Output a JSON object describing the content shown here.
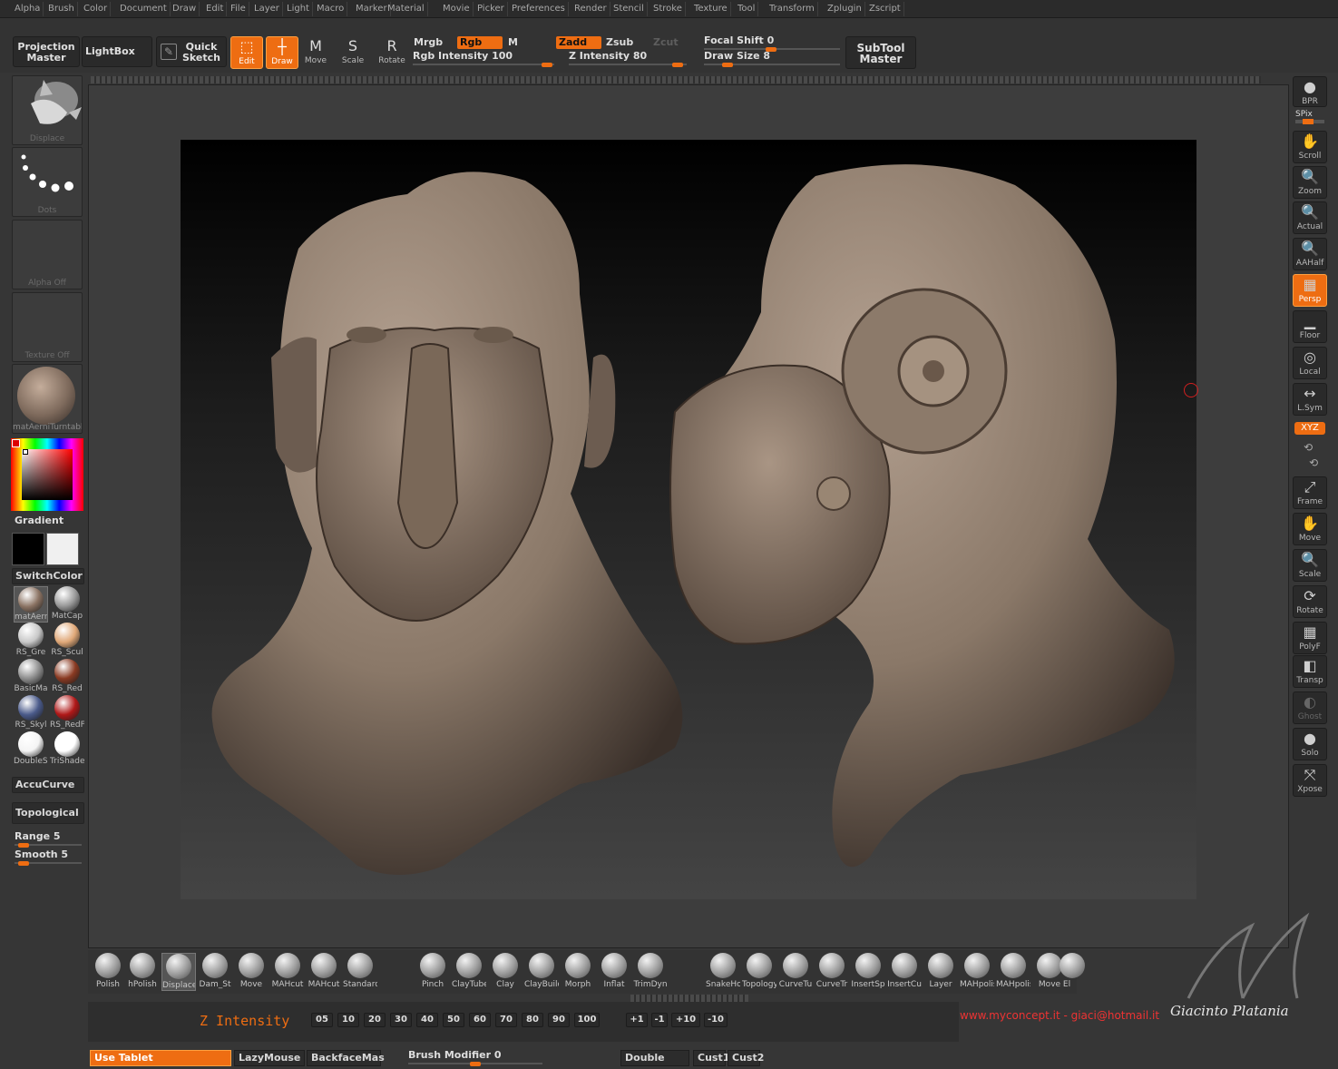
{
  "menu": [
    "Alpha",
    "Brush",
    "Color",
    "Document",
    "Draw",
    "Edit",
    "File",
    "Layer",
    "Light",
    "Macro",
    "Marker",
    "Material",
    "Movie",
    "Picker",
    "Preferences",
    "Render",
    "Stencil",
    "Stroke",
    "Texture",
    "Tool",
    "Transform",
    "Zplugin",
    "Zscript"
  ],
  "toolbar": {
    "projection_master": [
      "Projection",
      "Master"
    ],
    "lightbox": "LightBox",
    "quick_sketch": [
      "Quick",
      "Sketch"
    ],
    "edit": "Edit",
    "draw": "Draw",
    "move": "Move",
    "scale": "Scale",
    "rotate": "Rotate",
    "mrgb": "Mrgb",
    "rgb": "Rgb",
    "m": "M",
    "rgb_intensity": "Rgb Intensity 100",
    "rgb_intensity_value": 100,
    "zadd": "Zadd",
    "zsub": "Zsub",
    "zcut": "Zcut",
    "z_intensity": "Z Intensity 80",
    "z_intensity_value": 80,
    "focal_shift": "Focal Shift 0",
    "focal_shift_value": 0,
    "draw_size": "Draw Size 8",
    "draw_size_value": 8,
    "subtool_master": [
      "SubTool",
      "Master"
    ]
  },
  "left": {
    "brush_thumb": "Displace",
    "stroke_thumb": "Dots",
    "alpha_thumb": "Alpha  Off",
    "texture_thumb": "Texture  Off",
    "material_thumb": "matAerniTurntabl",
    "gradient": "Gradient",
    "switchcolor": "SwitchColor",
    "materials": [
      {
        "label": "matAerni",
        "color": "#8a7262"
      },
      {
        "label": "MatCap",
        "color": "#9a9a9a"
      },
      {
        "label": "RS_Gre",
        "color": "#c8c8c8"
      },
      {
        "label": "RS_Scul",
        "color": "#e0a878"
      },
      {
        "label": "BasicMa",
        "color": "#8e8e8e"
      },
      {
        "label": "RS_Red",
        "color": "#8a3a22"
      },
      {
        "label": "RS_Skyl",
        "color": "#4a5a8a"
      },
      {
        "label": "RS_RedF",
        "color": "#b01818"
      },
      {
        "label": "DoubleSh",
        "color": "#f4f4f4"
      },
      {
        "label": "TriShade",
        "color": "#ffffff"
      }
    ],
    "accucurve": "AccuCurve",
    "topological": "Topological",
    "range": "Range 5",
    "range_value": 5,
    "smooth": "Smooth 5",
    "smooth_value": 5
  },
  "right": [
    {
      "label": "BPR",
      "icon": "bpr-icon",
      "glyph": "●"
    },
    {
      "label": "Scroll",
      "icon": "scroll-icon",
      "glyph": "✋"
    },
    {
      "label": "Zoom",
      "icon": "zoom-icon",
      "glyph": "🔍"
    },
    {
      "label": "Actual",
      "icon": "actual-icon",
      "glyph": "🔍"
    },
    {
      "label": "AAHalf",
      "icon": "aahalf-icon",
      "glyph": "🔍"
    },
    {
      "label": "Persp",
      "icon": "persp-icon",
      "glyph": "▦"
    },
    {
      "label": "Floor",
      "icon": "floor-icon",
      "glyph": "▁"
    },
    {
      "label": "Local",
      "icon": "local-icon",
      "glyph": "◎"
    },
    {
      "label": "L.Sym",
      "icon": "lsym-icon",
      "glyph": "↔"
    },
    {
      "label": "Frame",
      "icon": "frame-icon",
      "glyph": "⤢"
    },
    {
      "label": "Move",
      "icon": "move-icon",
      "glyph": "✋"
    },
    {
      "label": "Scale",
      "icon": "scale-icon",
      "glyph": "🔍"
    },
    {
      "label": "Rotate",
      "icon": "rotate-icon",
      "glyph": "⟳"
    },
    {
      "label": "PolyF",
      "icon": "polyf-icon",
      "glyph": "▦"
    },
    {
      "label": "Transp",
      "icon": "transp-icon",
      "glyph": "◧"
    },
    {
      "label": "Ghost",
      "icon": "ghost-icon",
      "glyph": "◐"
    },
    {
      "label": "Solo",
      "icon": "solo-icon",
      "glyph": "●"
    },
    {
      "label": "Xpose",
      "icon": "xpose-icon",
      "glyph": "⤧"
    }
  ],
  "spix": "SPix",
  "xyz": "XYZ",
  "brushes": [
    "Polish",
    "hPolish",
    "Displace",
    "Dam_St",
    "Move",
    "MAHcut",
    "MAHcut",
    "Standard",
    "Pinch",
    "ClayTube",
    "Clay",
    "ClayBuild",
    "Morph",
    "Inflat",
    "TrimDyn",
    "SnakeHo",
    "Topology",
    "CurveTu",
    "CurveTr",
    "InsertSp",
    "InsertCu",
    "Layer",
    "MAHpolis",
    "MAHpolis",
    "Move",
    "El"
  ],
  "z_intensity_label": "Z Intensity",
  "z_presets": [
    "05",
    "10",
    "20",
    "30",
    "40",
    "50",
    "60",
    "70",
    "80",
    "90",
    "100"
  ],
  "z_steps": [
    "+1",
    "-1",
    "+10",
    "-10"
  ],
  "credit": "www.myconcept.it - giaci@hotmail.it",
  "signature": "Giacinto Platania",
  "bottom": {
    "use_tablet": "Use Tablet",
    "lazymouse": "LazyMouse",
    "backface": "BackfaceMas",
    "brush_modifier": "Brush Modifier 0",
    "brush_modifier_value": 0,
    "double": "Double",
    "cust1": "Cust1",
    "cust2": "Cust2"
  },
  "colors": {
    "accent": "#ee6d12",
    "clay": "#8f7d6d"
  }
}
